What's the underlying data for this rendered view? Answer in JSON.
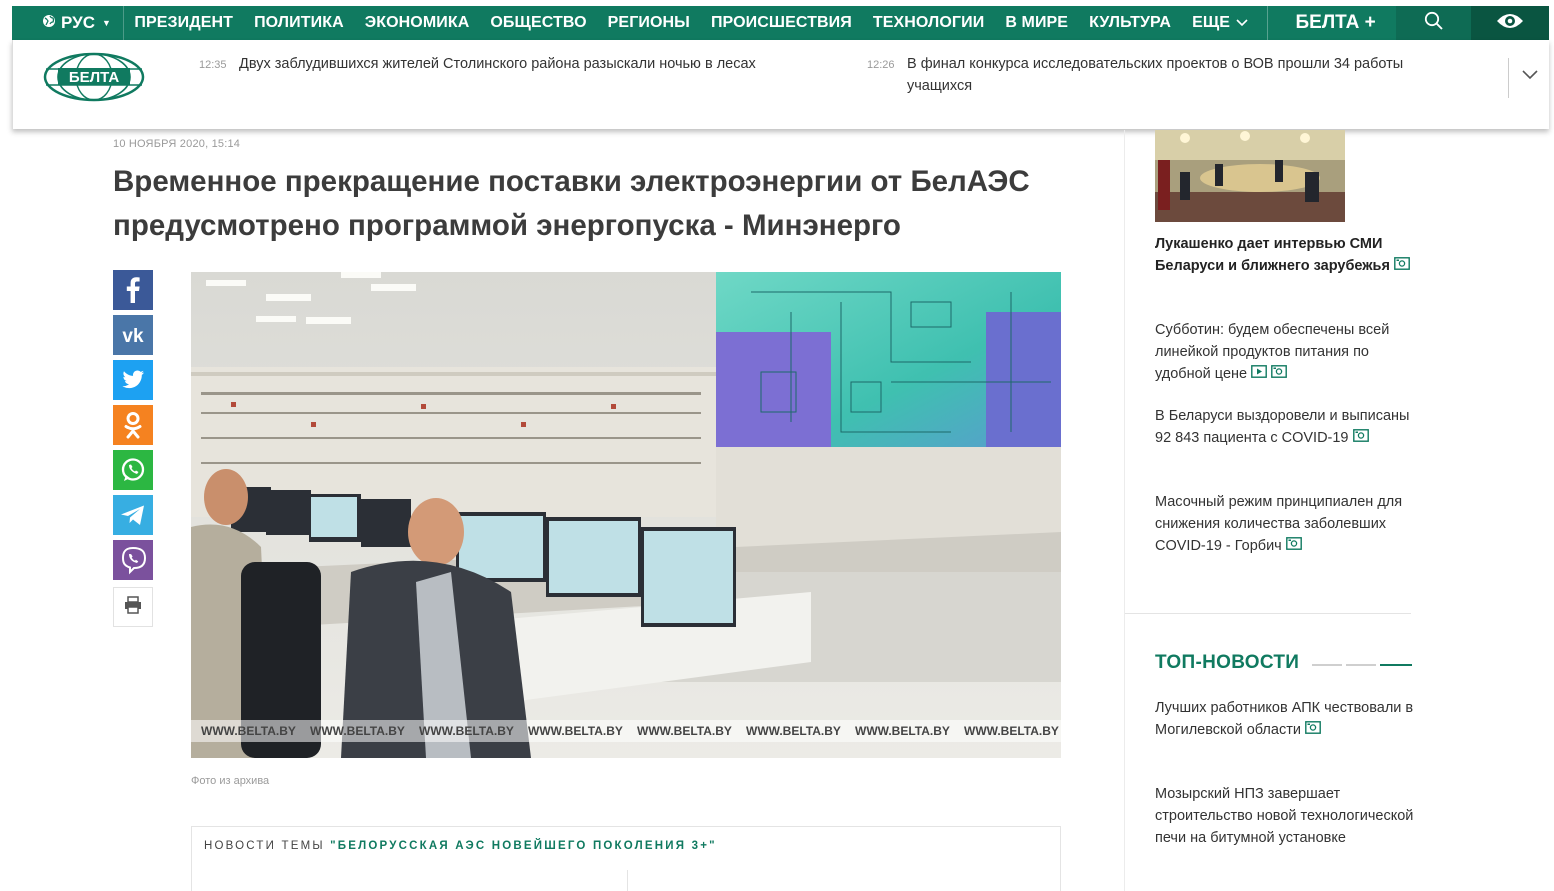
{
  "nav": {
    "lang": "РУС",
    "items": [
      "ПРЕЗИДЕНТ",
      "ПОЛИТИКА",
      "ЭКОНОМИКА",
      "ОБЩЕСТВО",
      "РЕГИОНЫ",
      "ПРОИСШЕСТВИЯ",
      "ТЕХНОЛОГИИ",
      "В МИРЕ",
      "КУЛЬТУРА"
    ],
    "more": "ЕЩЕ",
    "belta_plus": "БЕЛТА +",
    "icons": [
      "globe-icon",
      "search-icon",
      "eye-icon"
    ],
    "accent": "#107a60"
  },
  "header": {
    "logo_text": "БЕЛТА",
    "ticker": [
      {
        "time": "12:35",
        "text": "Двух заблудившихся жителей Столинского района разыскали ночью в лесах"
      },
      {
        "time": "12:26",
        "text": "В финал конкурса исследовательских проектов о ВОВ прошли 34 работы учащихся"
      }
    ]
  },
  "article": {
    "date": "10 НОЯБРЯ 2020, 15:14",
    "title": "Временное прекращение поставки электроэнергии от БелАЭС предусмотрено программой энергопуска - Минэнерго",
    "photo_watermark": "WWW.BELTA.BY",
    "photo_caption": "Фото из архива",
    "theme_label": "НОВОСТИ ТЕМЫ",
    "theme_name": "\"БЕЛОРУССКАЯ АЭС НОВЕЙШЕГО ПОКОЛЕНИЯ 3+\""
  },
  "share": [
    {
      "name": "facebook",
      "color": "#3b5998"
    },
    {
      "name": "vk",
      "color": "#4a76a8"
    },
    {
      "name": "twitter",
      "color": "#1da1f2"
    },
    {
      "name": "odnoklassniki",
      "color": "#f58220"
    },
    {
      "name": "whatsapp",
      "color": "#2cb742"
    },
    {
      "name": "telegram",
      "color": "#37aee2"
    },
    {
      "name": "viber",
      "color": "#7b519d"
    },
    {
      "name": "print",
      "color": "#ffffff"
    }
  ],
  "sidebar": {
    "items": [
      {
        "text": "Лукашенко дает интервью СМИ Беларуси и ближнего зарубежья",
        "bold": true,
        "icons": [
          "photo-icon"
        ]
      },
      {
        "text": "Субботин: будем обеспечены всей линейкой продуктов питания по удобной цене",
        "bold": false,
        "icons": [
          "video-icon",
          "photo-icon"
        ]
      },
      {
        "text": "В Беларуси выздоровели и выписаны 92 843 пациента с COVID-19",
        "bold": false,
        "icons": [
          "photo-icon"
        ]
      },
      {
        "text": "Масочный режим принципиален для снижения количества заболевших COVID-19 - Горбич",
        "bold": false,
        "icons": [
          "photo-icon"
        ]
      }
    ],
    "top_news_title": "ТОП-НОВОСТИ",
    "top_news": [
      {
        "text": "Лучших работников АПК чествовали в Могилевской области",
        "icons": [
          "photo-icon"
        ]
      },
      {
        "text": "Мозырский НПЗ завершает строительство новой технологической печи на битумной установке",
        "icons": []
      }
    ]
  }
}
